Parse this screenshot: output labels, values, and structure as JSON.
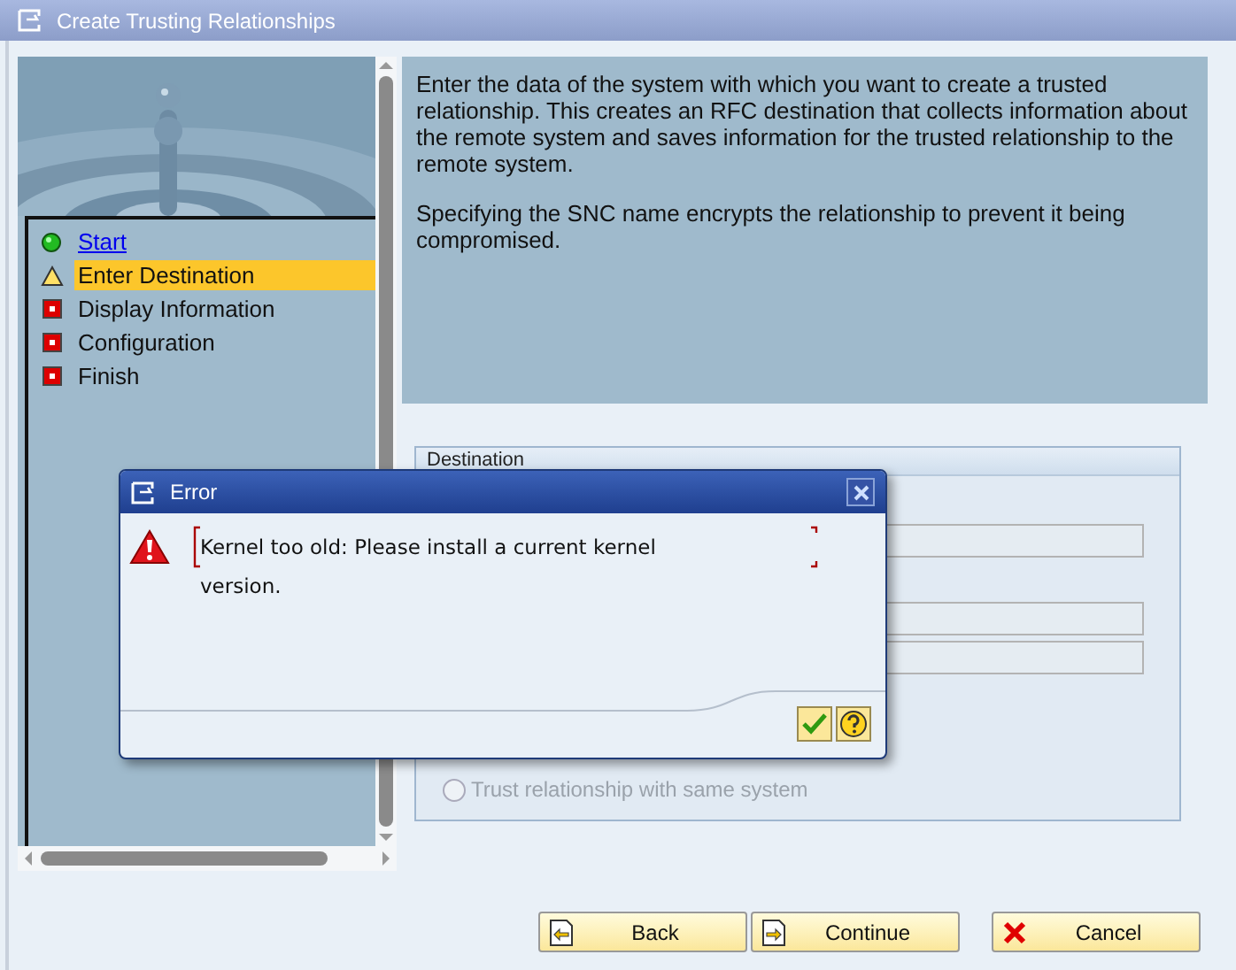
{
  "window": {
    "title": "Create Trusting Relationships"
  },
  "steps": [
    {
      "label": "Start",
      "kind": "done",
      "selected": false
    },
    {
      "label": "Enter Destination",
      "kind": "current",
      "selected": true
    },
    {
      "label": "Display Information",
      "kind": "pending",
      "selected": false
    },
    {
      "label": "Configuration",
      "kind": "pending",
      "selected": false
    },
    {
      "label": "Finish",
      "kind": "pending",
      "selected": false
    }
  ],
  "info": [
    "Enter the data of the system with which you want to create a trusted relationship. This creates an RFC destination that collects information about the remote system and saves information for the trusted relationship to the remote system.",
    "Specifying the SNC name encrypts the relationship to prevent it being compromised."
  ],
  "destination": {
    "title": "Destination",
    "fields": [
      {
        "kind": "field"
      },
      {
        "kind": "field"
      },
      {
        "kind": "field"
      }
    ],
    "radio": {
      "label": "Trust relationship with same system",
      "selected": false,
      "disabled": true
    }
  },
  "buttons": [
    {
      "label": "Back",
      "kind": "back"
    },
    {
      "label": "Continue",
      "kind": "continue"
    },
    {
      "label": "Cancel",
      "kind": "cancel"
    }
  ],
  "dialog": {
    "title": "Error",
    "message": "Kernel too old: Please install a current kernel version."
  }
}
